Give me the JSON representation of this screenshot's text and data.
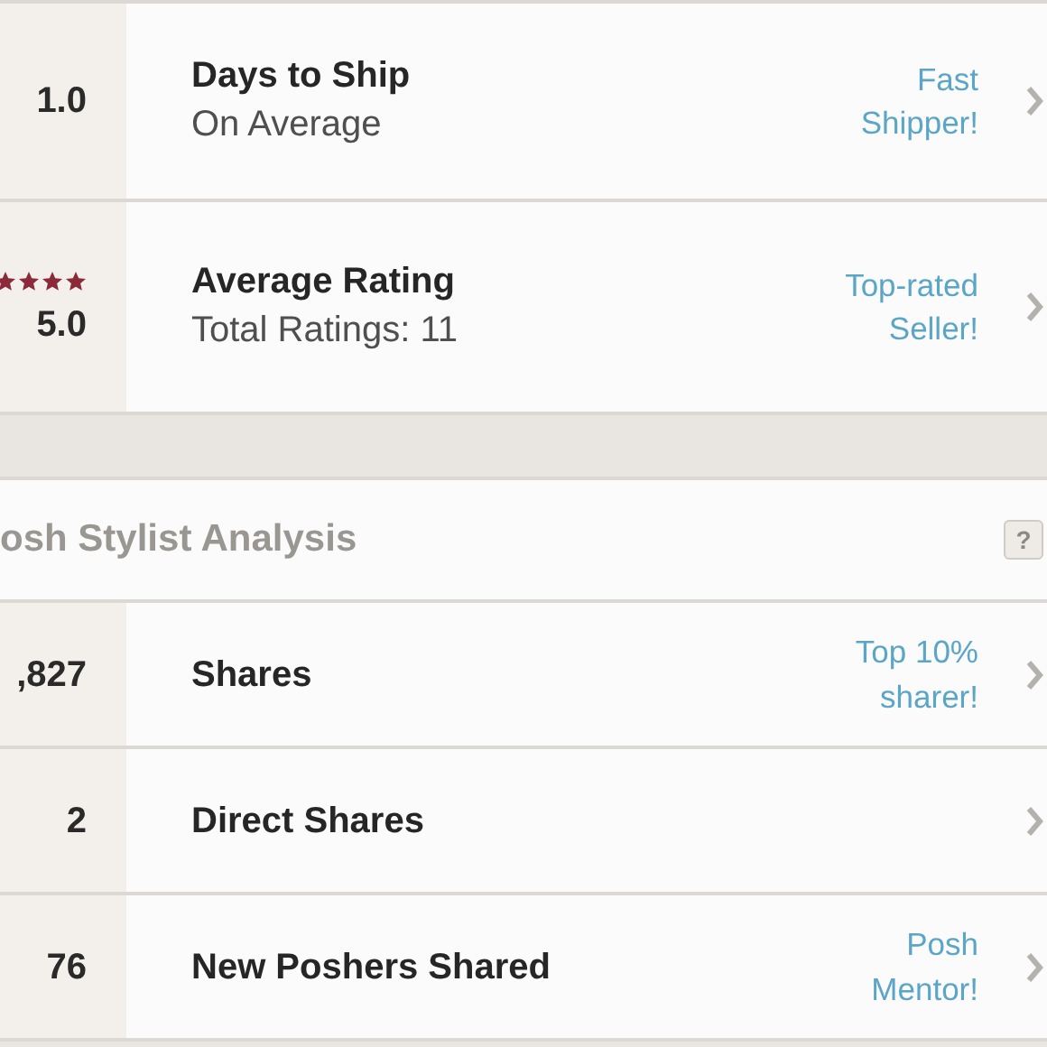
{
  "seller_stats": [
    {
      "value": "1.0",
      "title": "Days to Ship",
      "subtitle": "On Average",
      "badge": "Fast Shipper!"
    },
    {
      "value": "5.0",
      "stars": 4,
      "title": "Average Rating",
      "subtitle": "Total Ratings: 11",
      "badge": "Top-rated Seller!"
    }
  ],
  "stylist_analysis": {
    "heading": "osh Stylist Analysis",
    "help": "?",
    "rows": [
      {
        "value": ",827",
        "title": "Shares",
        "badge": "Top 10% sharer!"
      },
      {
        "value": "2",
        "title": "Direct Shares"
      },
      {
        "value": "76",
        "title": "New Poshers Shared",
        "badge": "Posh Mentor!"
      }
    ]
  }
}
